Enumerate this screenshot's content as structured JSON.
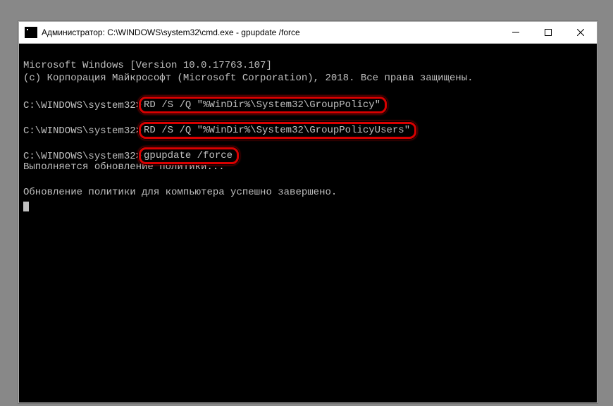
{
  "window": {
    "title": "Администратор: C:\\WINDOWS\\system32\\cmd.exe - gpupdate  /force"
  },
  "icons": {
    "app": "cmd-icon",
    "min": "minimize-icon",
    "max": "maximize-icon",
    "close": "close-icon"
  },
  "console": {
    "header1": "Microsoft Windows [Version 10.0.17763.107]",
    "header2": "(c) Корпорация Майкрософт (Microsoft Corporation), 2018. Все права защищены.",
    "prompt": "C:\\WINDOWS\\system32>",
    "cmd1": "RD /S /Q \"%WinDir%\\System32\\GroupPolicy\"",
    "cmd2": "RD /S /Q \"%WinDir%\\System32\\GroupPolicyUsers\"",
    "cmd3": "gpupdate /force",
    "progress": "Выполняется обновление политики...",
    "done": "Обновление политики для компьютера успешно завершено."
  },
  "highlight_color": "#d80000"
}
